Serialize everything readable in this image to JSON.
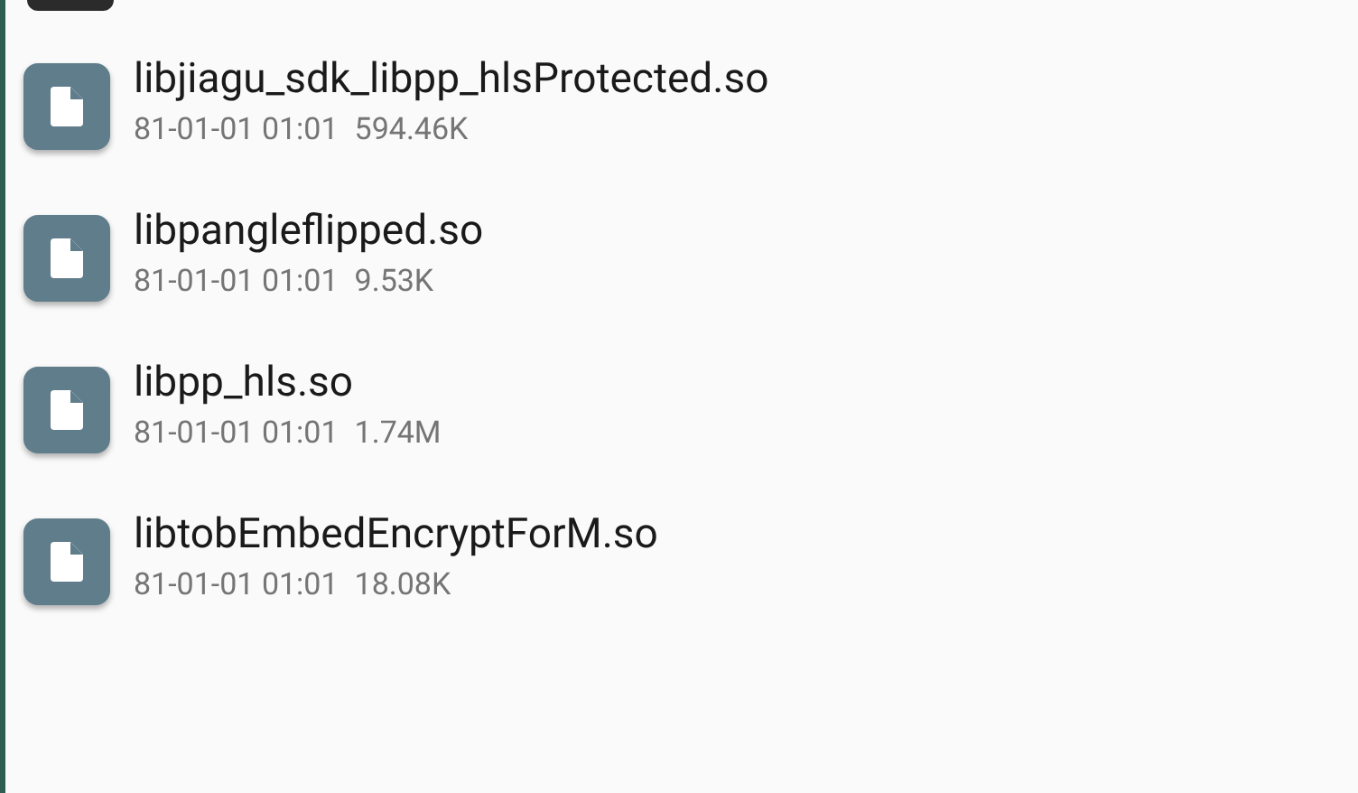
{
  "files": [
    {
      "name": "libjiagu_sdk_libpp_hlsProtected.so",
      "date": "81-01-01 01:01",
      "size": "594.46K"
    },
    {
      "name": "libpangleflipped.so",
      "date": "81-01-01 01:01",
      "size": "9.53K"
    },
    {
      "name": "libpp_hls.so",
      "date": "81-01-01 01:01",
      "size": "1.74M"
    },
    {
      "name": "libtobEmbedEncryptForM.so",
      "date": "81-01-01 01:01",
      "size": "18.08K"
    }
  ]
}
